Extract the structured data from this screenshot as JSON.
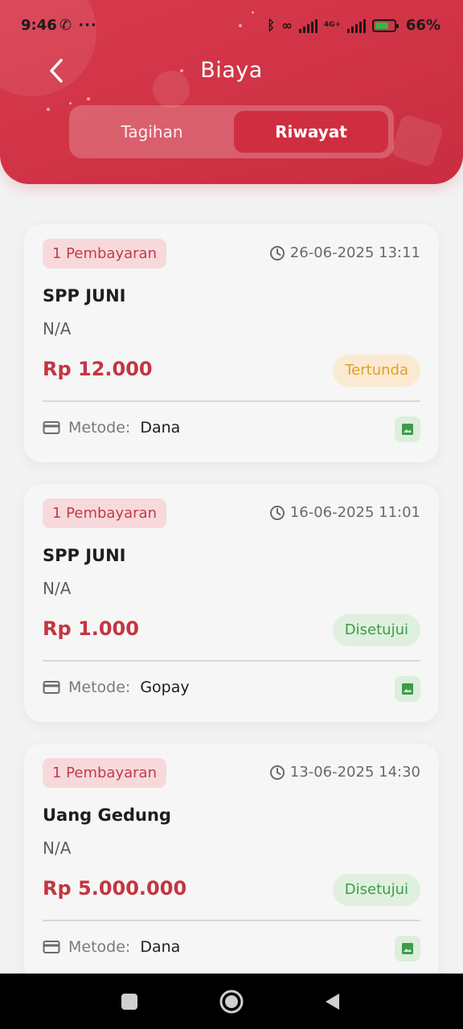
{
  "status_bar": {
    "time": "9:46",
    "left_icons": "✆ ···",
    "battery": "66%",
    "network": "4G+"
  },
  "header": {
    "title": "Biaya",
    "tabs": [
      {
        "label": "Tagihan",
        "active": false
      },
      {
        "label": "Riwayat",
        "active": true
      }
    ],
    "accent_color": "#cf3345"
  },
  "payments": [
    {
      "badge": "1 Pembayaran",
      "datetime": "26-06-2025 13:11",
      "title": "SPP JUNI",
      "subtitle": "N/A",
      "amount": "Rp 12.000",
      "status": "Tertunda",
      "method_label": "Metode:",
      "method": "Dana"
    },
    {
      "badge": "1 Pembayaran",
      "datetime": "16-06-2025 11:01",
      "title": "SPP JUNI",
      "subtitle": "N/A",
      "amount": "Rp 1.000",
      "status": "Disetujui",
      "method_label": "Metode:",
      "method": "Gopay"
    },
    {
      "badge": "1 Pembayaran",
      "datetime": "13-06-2025 14:30",
      "title": "Uang Gedung",
      "subtitle": "N/A",
      "amount": "Rp 5.000.000",
      "status": "Disetujui",
      "method_label": "Metode:",
      "method": "Dana"
    }
  ],
  "icons": {
    "back": "chevron-left-icon",
    "clock": "clock-icon",
    "card": "credit-card-icon",
    "proof": "image-icon"
  }
}
